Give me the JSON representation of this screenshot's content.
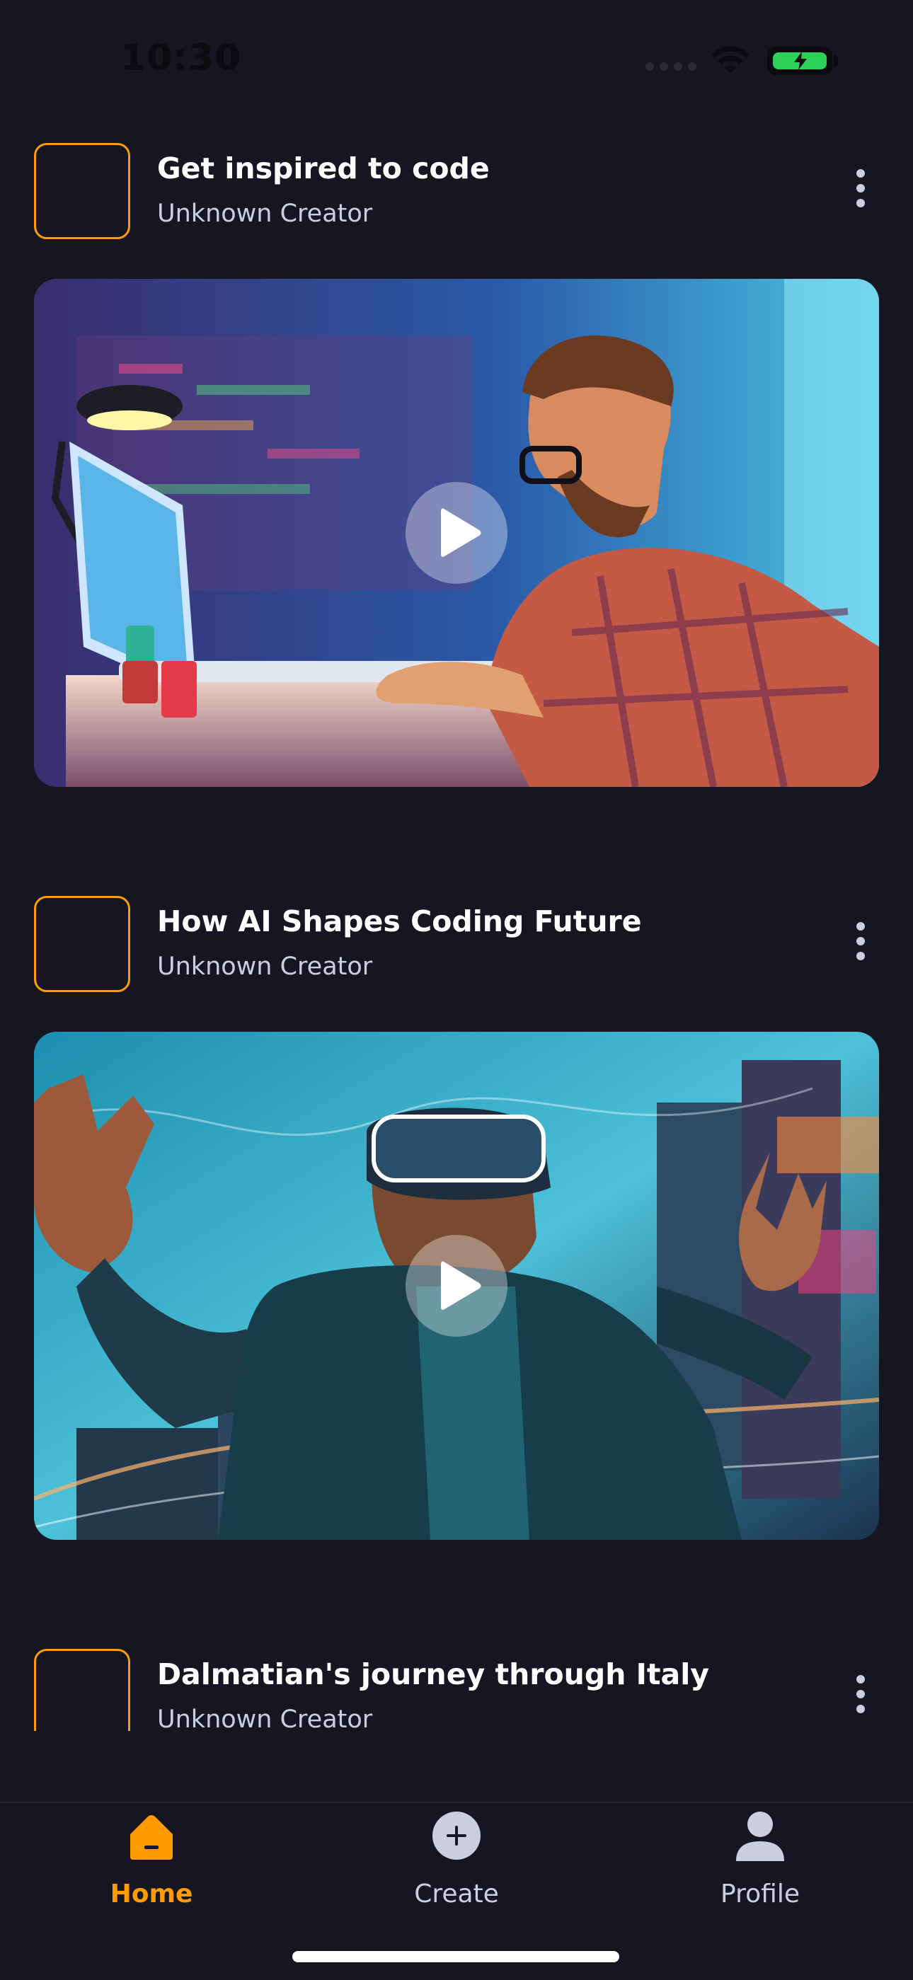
{
  "status_bar": {
    "time": "10:30"
  },
  "posts": [
    {
      "title": "Get inspired to code",
      "creator": "Unknown Creator"
    },
    {
      "title": "How AI Shapes Coding Future",
      "creator": "Unknown Creator"
    },
    {
      "title": "Dalmatian's journey through Italy",
      "creator": "Unknown Creator"
    }
  ],
  "tab_bar": {
    "tabs": [
      {
        "label": "Home",
        "icon": "home-icon",
        "active": true
      },
      {
        "label": "Create",
        "icon": "plus-icon",
        "active": false
      },
      {
        "label": "Profile",
        "icon": "user-icon",
        "active": false
      }
    ]
  },
  "colors": {
    "background": "#161622",
    "accent": "#ff9c01",
    "secondary_text": "#cdcde0",
    "battery": "#2ed158"
  }
}
